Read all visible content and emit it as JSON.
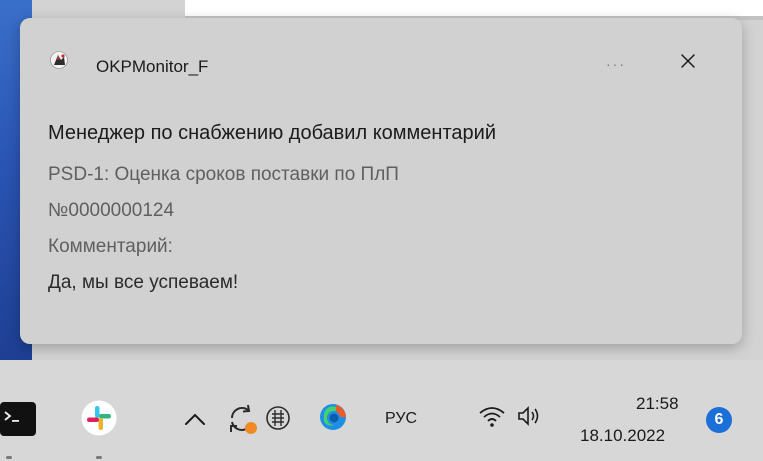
{
  "background": {
    "accent_color": "#2a55b4"
  },
  "toast": {
    "app_icon": "okpmonitor-app-icon",
    "app_name": "OKPMonitor_F",
    "more_label": "···",
    "close_icon": "close-icon",
    "title": "Менеджер по снабжению добавил комментарий",
    "lines": [
      "PSD-1: Оценка сроков поставки по ПлП",
      "№0000000124",
      "Комментарий:",
      "Да, мы все успеваем!"
    ]
  },
  "taskbar": {
    "pinned_apps": [
      "terminal-icon",
      "slack-icon"
    ],
    "tray_icons": [
      "chevron-up-icon",
      "sync-icon",
      "grid-app-icon",
      "edge-icon"
    ],
    "language": "РУС",
    "network_icon": "wifi-icon",
    "volume_icon": "speaker-icon",
    "time": "21:58",
    "date": "18.10.2022",
    "notification_count": "6",
    "badge_color": "#1a6fd8"
  }
}
